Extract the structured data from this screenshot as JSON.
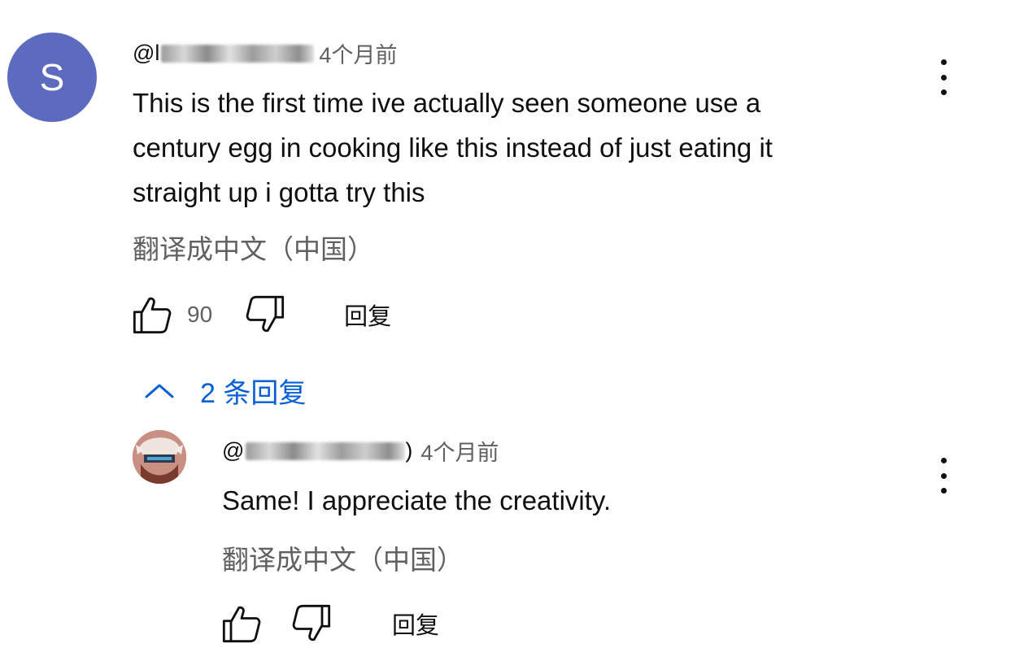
{
  "comment": {
    "avatar_letter": "S",
    "avatar_color": "#5c6bc0",
    "handle_prefix": "@l",
    "time": "4个月前",
    "lines": [
      "This is the first time ive actually seen someone use a",
      "century egg in cooking like this instead of just eating it",
      "straight up i gotta try this"
    ],
    "translate": "翻译成中文（中国）",
    "likes": "90",
    "reply_label": "回复",
    "replies_toggle": "2 条回复"
  },
  "reply": {
    "handle_prefix": "@",
    "handle_suffix": ")",
    "time": "4个月前",
    "text": "Same! I appreciate the creativity.",
    "translate": "翻译成中文（中国）",
    "reply_label": "回复"
  },
  "colors": {
    "link_blue": "#065fd4",
    "secondary_text": "#606060",
    "primary_text": "#0f0f0f"
  },
  "icons": {
    "like": "thumbs-up-icon",
    "dislike": "thumbs-down-icon",
    "more": "more-vertical-icon",
    "collapse": "chevron-up-icon"
  }
}
